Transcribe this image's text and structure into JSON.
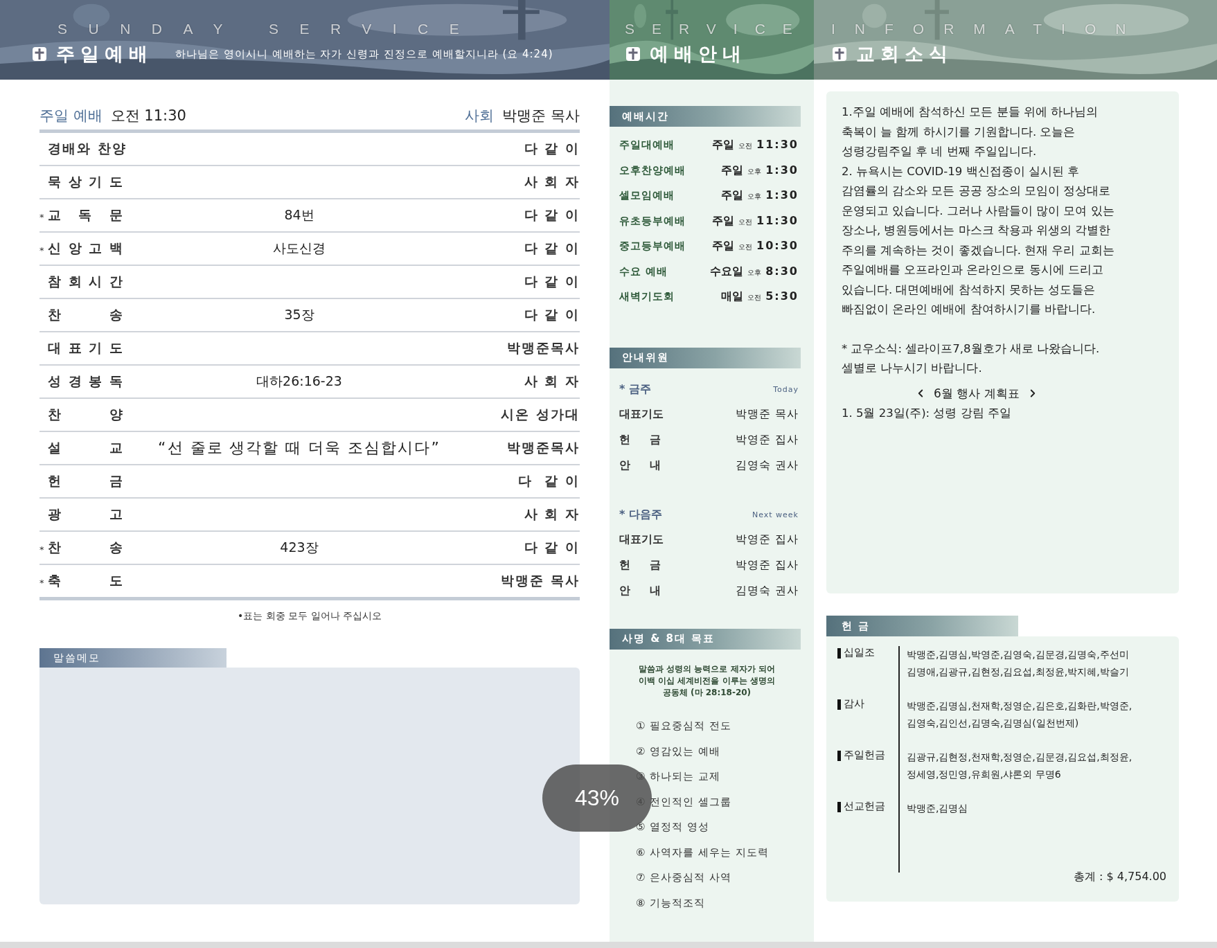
{
  "header": {
    "sections": [
      {
        "subtitle": "SUNDAY SERVICE",
        "title": "주일예배",
        "verse": "하나님은 영이시니 예배하는 자가 신령과 진정으로 예배할지니라 (요 4:24)"
      },
      {
        "subtitle": "SERVICE",
        "title": "예배안내"
      },
      {
        "subtitle": "INFORMATION",
        "title": "교회소식"
      }
    ]
  },
  "service": {
    "label": "주일 예배",
    "time": "오전 11:30",
    "host_label": "사회",
    "host": "박맹준 목사",
    "rows": [
      {
        "label": "경배와 찬양",
        "leader": "다 같 이"
      },
      {
        "label": "묵 상 기 도",
        "leader": "사 회 자"
      },
      {
        "marker": "*",
        "label": "교 독 문",
        "item": "84번",
        "leader": "다 같 이"
      },
      {
        "marker": "*",
        "label": "신 앙 고 백",
        "item": "사도신경",
        "leader": "다 같 이"
      },
      {
        "label": "참 회 시 간",
        "leader": "다 같 이"
      },
      {
        "label": "찬 송",
        "item": "35장",
        "leader": "다 같 이"
      },
      {
        "label": "대 표 기 도",
        "leader": "박맹준목사"
      },
      {
        "label": "성 경 봉 독",
        "item": "대하26:16-23",
        "leader": "사 회 자"
      },
      {
        "label": "찬 양",
        "leader": "시온 성가대"
      },
      {
        "label": "설 교",
        "item": "“선 줄로 생각할 때 더욱 조심합시다”",
        "leader": "박맹준목사"
      },
      {
        "label": "헌 금",
        "leader": "다  같 이"
      },
      {
        "label": "광 고",
        "leader": "사 회 자"
      },
      {
        "marker": "*",
        "label": "찬 송",
        "item": "423장",
        "leader": "다 같 이"
      },
      {
        "marker": "*",
        "label": "축 도",
        "leader": "박맹준 목사"
      }
    ],
    "note": "•표는 회중 모두 일어나 주십시오"
  },
  "memo": {
    "title": "말씀메모"
  },
  "schedule": {
    "title": "예배시간",
    "rows": [
      {
        "name": "주일대예배",
        "day": "주일",
        "ampm": "오전",
        "time": "11:30"
      },
      {
        "name": "오후찬양예배",
        "day": "주일",
        "ampm": "오후",
        "time": "1:30"
      },
      {
        "name": "셀모임예배",
        "day": "주일",
        "ampm": "오후",
        "time": "1:30"
      },
      {
        "name": "유초등부예배",
        "day": "주일",
        "ampm": "오전",
        "time": "11:30"
      },
      {
        "name": "중고등부예배",
        "day": "주일",
        "ampm": "오전",
        "time": "10:30"
      },
      {
        "name": "수요 예배",
        "day": "수요일",
        "ampm": "오후",
        "time": "8:30"
      },
      {
        "name": "새벽기도회",
        "day": "매일",
        "ampm": "오전",
        "time": "5:30"
      }
    ]
  },
  "ushers": {
    "title": "안내위원",
    "groups": [
      {
        "title": "* 금주",
        "note": "Today",
        "rows": [
          {
            "role": "대표기도",
            "name": "박맹준 목사"
          },
          {
            "role": "헌 금",
            "name": "박영준 집사"
          },
          {
            "role": "안 내",
            "name": "김영숙 권사"
          }
        ]
      },
      {
        "title": "* 다음주",
        "note": "Next week",
        "rows": [
          {
            "role": "대표기도",
            "name": "박영준 집사"
          },
          {
            "role": "헌 금",
            "name": "박영준 집사"
          },
          {
            "role": "안 내",
            "name": "김명숙 권사"
          }
        ]
      }
    ]
  },
  "mission": {
    "title": "사명 & 8대 목표",
    "statement_lines": [
      "말씀과 성령의 능력으로 제자가 되어",
      "이백 이십 세계비전을 이루는 생명의",
      "공동체 (마 28:18-20)"
    ],
    "goals": [
      "① 필요중심적 전도",
      "② 영감있는 예배",
      "③ 하나되는 교제",
      "④ 전인적인 셀그룹",
      "⑤ 열정적 영성",
      "⑥ 사역자를 세우는 지도력",
      "⑦ 은사중심적 사역",
      "⑧ 기능적조직"
    ]
  },
  "news": {
    "paragraphs": [
      [
        "1.주일 예배에 참석하신 모든 분들 위에 하나님의",
        "축복이 늘 함께 하시기를 기원합니다. 오늘은",
        "성령강림주일 후 네 번째 주일입니다."
      ],
      [
        "2. 뉴욕시는 COVID-19 백신접종이 실시된 후",
        "감염률의 감소와 모든 공공 장소의 모임이 정상대로",
        "운영되고 있습니다. 그러나 사람들이 많이 모여 있는",
        "장소나, 병원등에서는 마스크 착용과 위생의 각별한",
        "주의를 계속하는 것이 좋겠습니다. 현재 우리 교회는",
        "주일예배를 오프라인과 온라인으로 동시에 드리고",
        "있습니다. 대면예배에 참석하지 못하는 성도들은",
        "빠짐없이 온라인 예배에 참여하시기를 바랍니다."
      ],
      [
        "* 교우소식: 셀라이프7,8월호가 새로 나왔습니다.",
        "셀별로 나누시기 바랍니다."
      ]
    ],
    "plan_title": "6월 행사 계획표",
    "plan_items": [
      "1. 5월 23일(주): 성령 강림 주일"
    ]
  },
  "offering": {
    "title": "헌 금",
    "categories": [
      {
        "name": "십일조",
        "lines": [
          "박맹준,김명심,박영준,김영숙,김문경,김명숙,주선미",
          "김명애,김광규,김현정,김요섭,최정윤,박지혜,박슬기"
        ]
      },
      {
        "name": "감사",
        "lines": [
          "박맹준,김명심,천재학,정영순,김은호,김화란,박영준,",
          "김영숙,김인선,김명숙,김명심(일천번제)"
        ]
      },
      {
        "name": "주일헌금",
        "lines": [
          "김광규,김현정,천재학,정영순,김문경,김요섭,최정윤,",
          "정세영,정민영,유희원,샤론외  무명6"
        ]
      },
      {
        "name": "선교헌금",
        "lines": [
          "박맹준,김명심"
        ]
      }
    ],
    "total": "총계 : $ 4,754.00"
  },
  "zoom_overlay": {
    "text": "43%"
  }
}
